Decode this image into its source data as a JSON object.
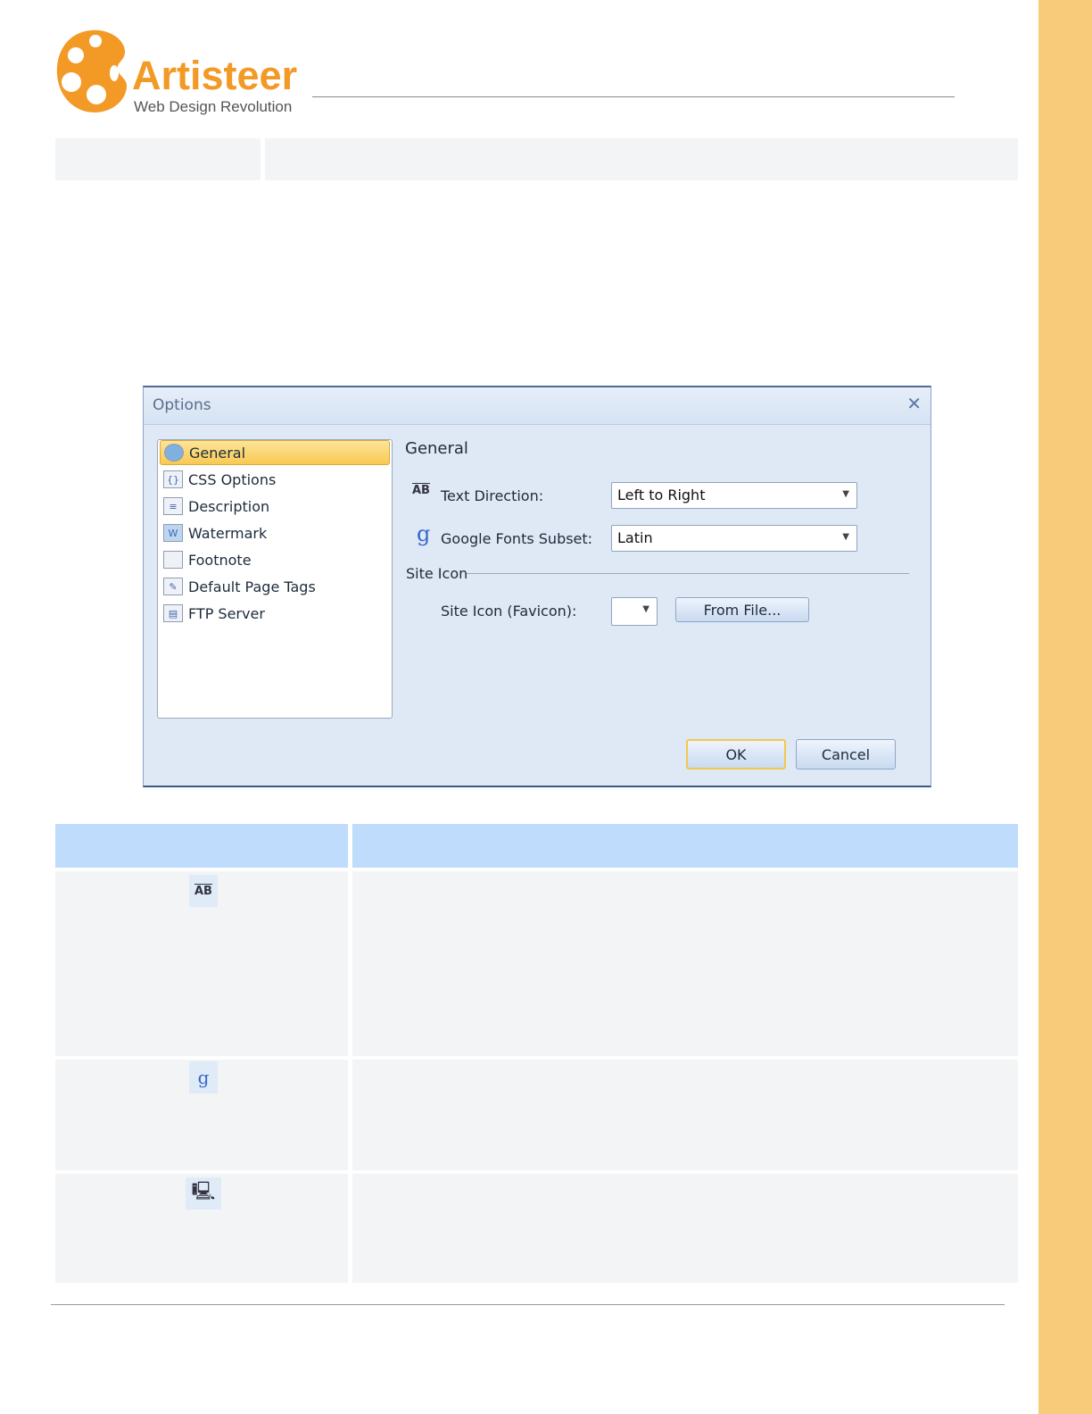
{
  "brand": {
    "name": "Artisteer",
    "tagline": "Web Design Revolution",
    "color": "#f39a26"
  },
  "dialog": {
    "title": "Options",
    "close_icon": "close-icon",
    "nav": [
      {
        "label": "General",
        "icon": "globe-icon",
        "selected": true
      },
      {
        "label": "CSS Options",
        "icon": "css-icon"
      },
      {
        "label": "Description",
        "icon": "description-icon"
      },
      {
        "label": "Watermark",
        "icon": "watermark-icon"
      },
      {
        "label": "Footnote",
        "icon": "footnote-icon"
      },
      {
        "label": "Default Page Tags",
        "icon": "tags-icon"
      },
      {
        "label": "FTP Server",
        "icon": "ftp-icon"
      }
    ],
    "section_title": "General",
    "text_direction": {
      "label": "Text Direction:",
      "value": "Left to Right"
    },
    "google_fonts": {
      "label": "Google Fonts Subset:",
      "value": "Latin"
    },
    "site_icon_group": "Site Icon",
    "favicon": {
      "label": "Site Icon (Favicon):",
      "value": ""
    },
    "from_file": "From File...",
    "ok": "OK",
    "cancel": "Cancel"
  },
  "table": {
    "rows": [
      {
        "icon": "text-direction-icon"
      },
      {
        "icon": "google-fonts-icon"
      },
      {
        "icon": "devices-icon"
      }
    ]
  },
  "colors": {
    "accent_strip": "#f7cb7a",
    "table_header": "#bfdcfc"
  }
}
